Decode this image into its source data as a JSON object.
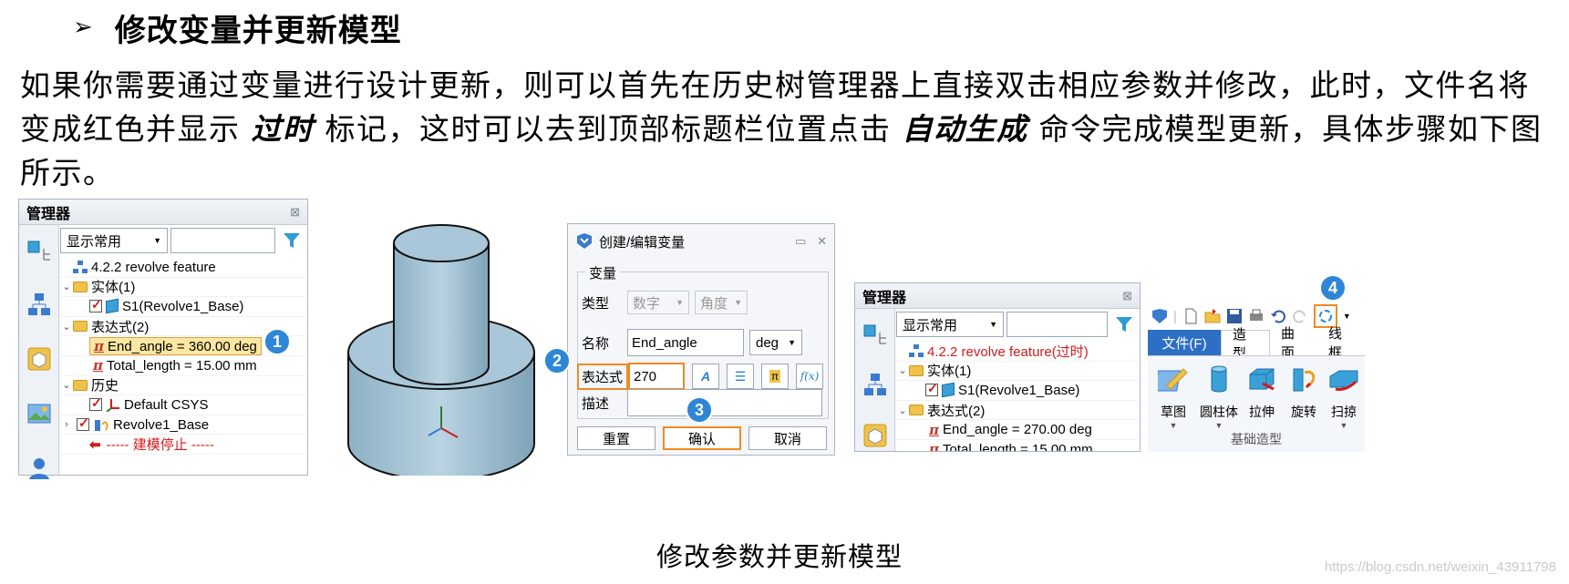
{
  "heading": {
    "bullet": "➢",
    "text": "修改变量并更新模型"
  },
  "paragraph": {
    "part1": "如果你需要通过变量进行设计更新，则可以首先在历史树管理器上直接双击相应参数并修改，此时，文件名将变成红色并显示 ",
    "em1": "过时",
    "part2": " 标记，这时可以去到顶部标题栏位置点击 ",
    "em2": "自动生成",
    "part3": " 命令完成模型更新，具体步骤如下图所示。"
  },
  "manager1": {
    "title": "管理器",
    "filter_value": "显示常用",
    "tree": {
      "root": "4.2.2 revolve feature",
      "solid_group": "实体(1)",
      "solid_item": "S1(Revolve1_Base)",
      "expr_group": "表达式(2)",
      "expr1": "End_angle = 360.00 deg",
      "expr2": "Total_length = 15.00 mm",
      "history_group": "历史",
      "hist1": "Default CSYS",
      "hist2": "Revolve1_Base",
      "stop": "----- 建模停止 -----"
    }
  },
  "dialog": {
    "title": "创建/编辑变量",
    "group_label": "变量",
    "type_label": "类型",
    "type_value": "数字",
    "unit_type_value": "角度",
    "name_label": "名称",
    "name_value": "End_angle",
    "unit_value": "deg",
    "expr_label": "表达式",
    "expr_value": "270",
    "desc_label": "描述",
    "reset_label": "重置",
    "confirm_label": "确认",
    "cancel_label": "取消"
  },
  "manager2": {
    "title": "管理器",
    "filter_value": "显示常用",
    "tree": {
      "root": "4.2.2 revolve feature(过时)",
      "solid_group": "实体(1)",
      "solid_item": "S1(Revolve1_Base)",
      "expr_group": "表达式(2)",
      "expr1": "End_angle = 270.00 deg",
      "expr2": "Total_length = 15.00 mm"
    }
  },
  "toolbar": {
    "tabs": [
      "文件(F)",
      "造型",
      "曲面",
      "线框"
    ],
    "buttons": [
      "草图",
      "圆柱体",
      "拉伸",
      "旋转",
      "扫掠"
    ],
    "group_label": "基础造型"
  },
  "badges": [
    "1",
    "2",
    "3",
    "4"
  ],
  "caption": "修改参数并更新模型",
  "watermark": "https://blog.csdn.net/weixin_43911798",
  "colors": {
    "accent_orange": "#f08a24",
    "badge_blue": "#2e86d6",
    "outdated_red": "#d21a1a"
  }
}
